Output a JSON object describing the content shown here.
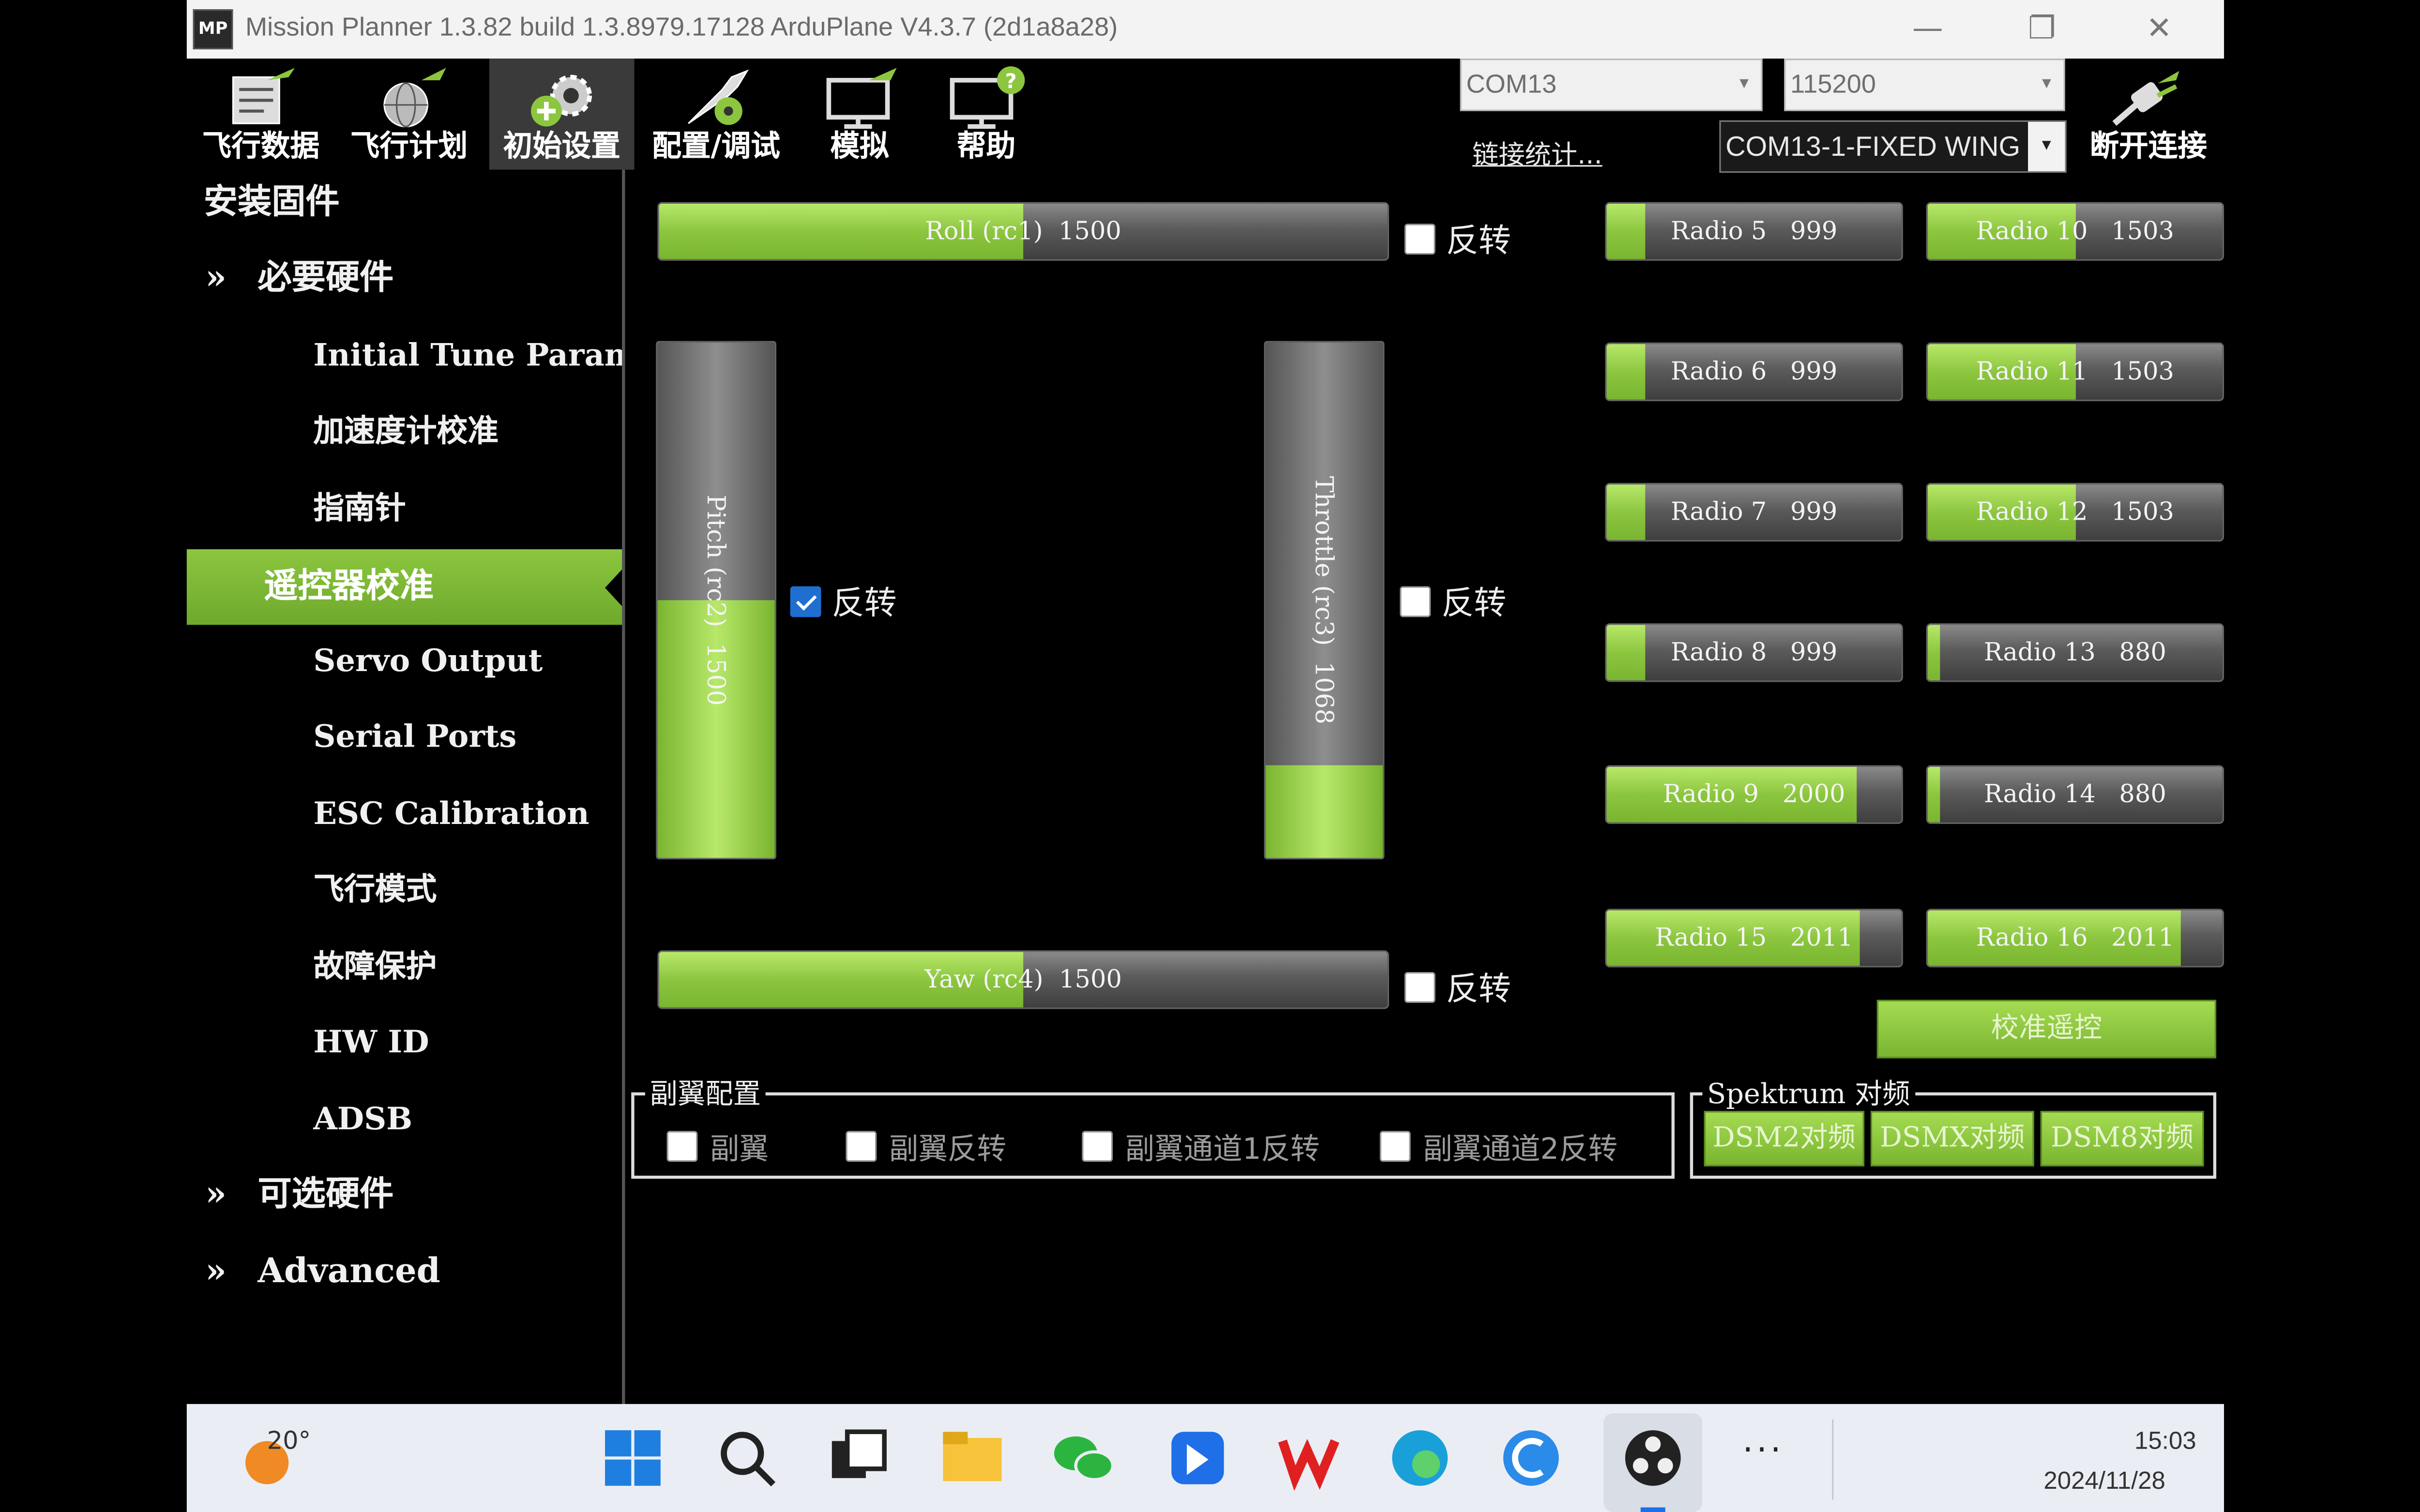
{
  "window": {
    "title": "Mission Planner 1.3.82 build 1.3.8979.17128 ArduPlane V4.3.7 (2d1a8a28)",
    "app_icon_text": "MP"
  },
  "toolbar": {
    "items": [
      {
        "label": "飞行数据",
        "icon": "flight-data-icon"
      },
      {
        "label": "飞行计划",
        "icon": "flight-plan-icon"
      },
      {
        "label": "初始设置",
        "icon": "initial-setup-icon"
      },
      {
        "label": "配置/调试",
        "icon": "config-tuning-icon"
      },
      {
        "label": "模拟",
        "icon": "simulation-icon"
      },
      {
        "label": "帮助",
        "icon": "help-icon"
      }
    ],
    "port": "COM13",
    "baud": "115200",
    "stats_link": "链接统计...",
    "connection": "COM13-1-FIXED WING",
    "disconnect_label": "断开连接"
  },
  "sidebar": {
    "install_firmware": "安装固件",
    "mandatory_hardware": "必要硬件",
    "items": [
      "Initial Tune Parameters",
      "加速度计校准",
      "指南针",
      "遥控器校准",
      "Servo Output",
      "Serial Ports",
      "ESC Calibration",
      "飞行模式",
      "故障保护",
      "HW ID",
      "ADSB"
    ],
    "optional_hardware": "可选硬件",
    "advanced": "Advanced",
    "chevron": "»"
  },
  "radio": {
    "roll": {
      "label": "Roll (rc1)  1500",
      "level": 0.5,
      "reverse": false
    },
    "pitch": {
      "label": "Pitch (rc2)  1500",
      "level": 0.5,
      "reverse": true
    },
    "throttle": {
      "label": "Throttle (rc3)  1068",
      "level": 0.18,
      "reverse": false
    },
    "yaw": {
      "label": "Yaw (rc4)  1500",
      "level": 0.5,
      "reverse": false
    },
    "reverse_label": "反转",
    "channels": [
      {
        "label": "Radio 5   999",
        "level": 0.13
      },
      {
        "label": "Radio 10   1503",
        "level": 0.5
      },
      {
        "label": "Radio 6   999",
        "level": 0.13
      },
      {
        "label": "Radio 11   1503",
        "level": 0.5
      },
      {
        "label": "Radio 7   999",
        "level": 0.13
      },
      {
        "label": "Radio 12   1503",
        "level": 0.5
      },
      {
        "label": "Radio 8   999",
        "level": 0.13
      },
      {
        "label": "Radio 13   880",
        "level": 0.04
      },
      {
        "label": "Radio 9   2000",
        "level": 0.85
      },
      {
        "label": "Radio 14   880",
        "level": 0.04
      },
      {
        "label": "Radio 15   2011",
        "level": 0.86
      },
      {
        "label": "Radio 16   2011",
        "level": 0.86
      }
    ],
    "calibrate_button": "校准遥控"
  },
  "elevon": {
    "title": "副翼配置",
    "options": [
      "副翼",
      "副翼反转",
      "副翼通道1反转",
      "副翼通道2反转"
    ]
  },
  "spektrum": {
    "title": "Spektrum 对频",
    "buttons": [
      "DSM2对频",
      "DSMX对频",
      "DSM8对频"
    ]
  },
  "taskbar": {
    "weather": "20°",
    "time": "15:03",
    "date": "2024/11/28",
    "more": "···"
  },
  "colors": {
    "accent_green": "#8cc63f",
    "checkbox_blue": "#1e6fcf",
    "background": "#000000"
  }
}
